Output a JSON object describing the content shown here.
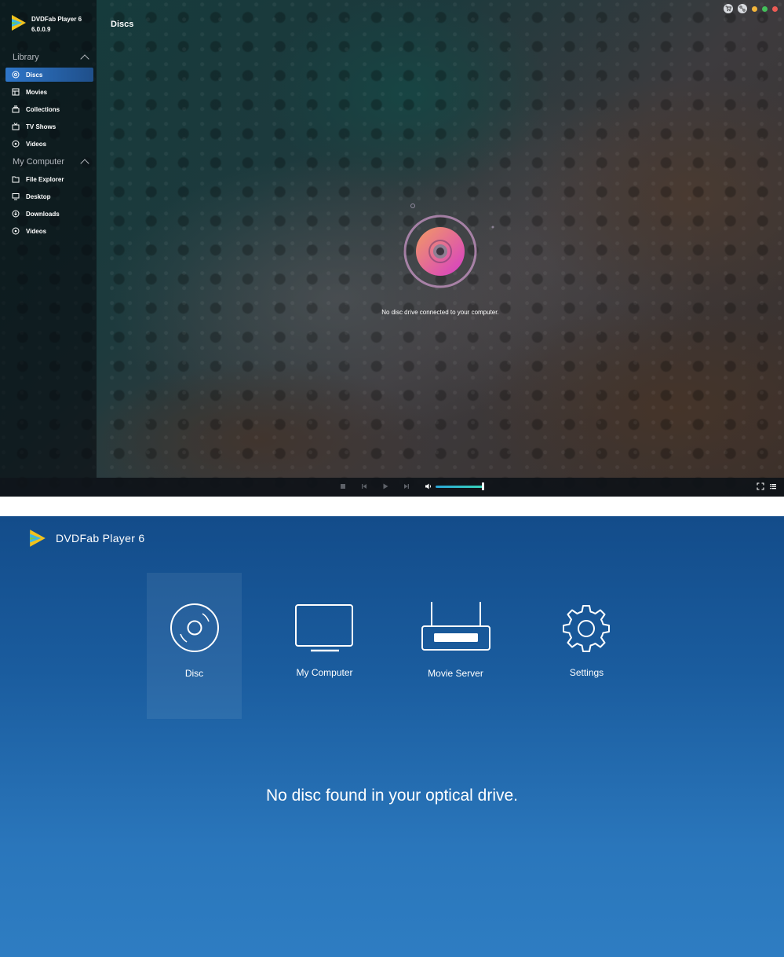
{
  "app": {
    "name": "DVDFab Player 6",
    "version": "6.0.0.9"
  },
  "sidebar": {
    "sections": [
      {
        "title": "Library",
        "items": [
          {
            "label": "Discs",
            "icon": "disc-icon",
            "active": true
          },
          {
            "label": "Movies",
            "icon": "film-icon"
          },
          {
            "label": "Collections",
            "icon": "collections-icon"
          },
          {
            "label": "TV Shows",
            "icon": "tv-icon"
          },
          {
            "label": "Videos",
            "icon": "video-icon"
          }
        ]
      },
      {
        "title": "My Computer",
        "items": [
          {
            "label": "File Explorer",
            "icon": "folder-icon"
          },
          {
            "label": "Desktop",
            "icon": "desktop-icon"
          },
          {
            "label": "Downloads",
            "icon": "download-icon"
          },
          {
            "label": "Videos",
            "icon": "video-icon"
          }
        ]
      }
    ]
  },
  "main": {
    "title": "Discs",
    "empty_message": "No disc drive connected to your computer."
  },
  "player": {
    "volume": 0.98
  },
  "colors": {
    "accent": "#2e76c9",
    "disc_gradient_start": "#f29b62",
    "disc_gradient_end": "#d63cc8",
    "bottom_bg_top": "#134c8a",
    "bottom_bg_bottom": "#2e7dc2"
  },
  "home": {
    "title": "DVDFab Player 6",
    "tiles": [
      {
        "label": "Disc",
        "icon": "disc-icon",
        "selected": true
      },
      {
        "label": "My Computer",
        "icon": "monitor-icon"
      },
      {
        "label": "Movie Server",
        "icon": "router-icon"
      },
      {
        "label": "Settings",
        "icon": "gear-icon"
      }
    ],
    "message": "No disc found in your optical drive."
  }
}
